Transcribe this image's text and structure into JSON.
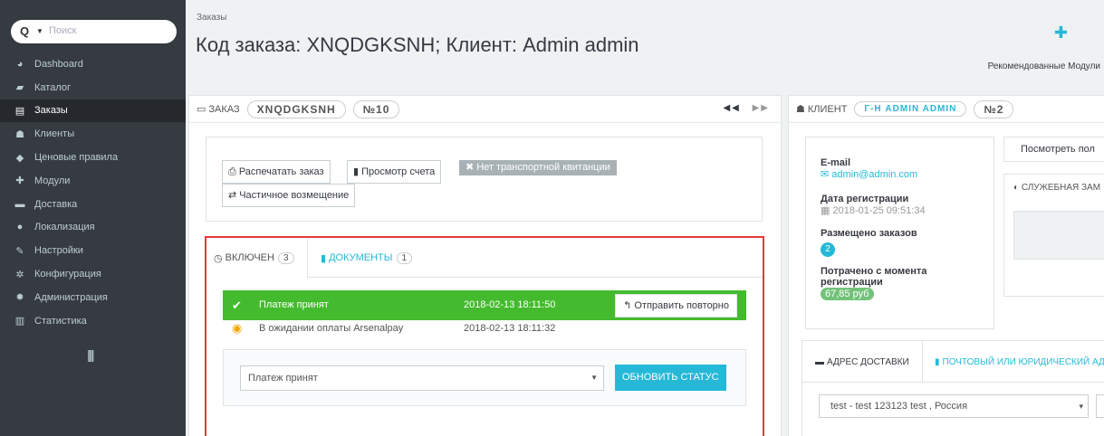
{
  "search": {
    "placeholder": "Поиск"
  },
  "sidebar": {
    "items": [
      {
        "label": "Dashboard",
        "icon": "dashboard-icon",
        "glyph": "◕",
        "active": false
      },
      {
        "label": "Каталог",
        "icon": "catalog-icon",
        "glyph": "▰",
        "active": false
      },
      {
        "label": "Заказы",
        "icon": "orders-icon",
        "glyph": "▤",
        "active": true
      },
      {
        "label": "Клиенты",
        "icon": "customers-icon",
        "glyph": "☗",
        "active": false
      },
      {
        "label": "Ценовые правила",
        "icon": "price-rules-icon",
        "glyph": "◆",
        "active": false
      },
      {
        "label": "Модули",
        "icon": "modules-icon",
        "glyph": "✚",
        "active": false
      },
      {
        "label": "Доставка",
        "icon": "delivery-icon",
        "glyph": "▬",
        "active": false
      },
      {
        "label": "Локализация",
        "icon": "localization-icon",
        "glyph": "●",
        "active": false
      },
      {
        "label": "Настройки",
        "icon": "settings-icon",
        "glyph": "✎",
        "active": false
      },
      {
        "label": "Конфигурация",
        "icon": "configuration-icon",
        "glyph": "✲",
        "active": false
      },
      {
        "label": "Администрация",
        "icon": "administration-icon",
        "glyph": "✹",
        "active": false
      },
      {
        "label": "Статистика",
        "icon": "statistics-icon",
        "glyph": "▥",
        "active": false
      }
    ],
    "collapse_glyph": "||||"
  },
  "header": {
    "breadcrumb": "Заказы",
    "title": "Код заказа: XNQDGKSNH; Клиент: Admin admin",
    "modules_label": "Рекомендованные Модули"
  },
  "order_panel": {
    "heading": "ЗАКАЗ",
    "reference": "XNQDGKSNH",
    "number": "№10",
    "buttons": {
      "print": "Распечатать заказ",
      "invoice": "Просмотр счета",
      "no_delivery_slip": "Нет транспортной квитанции",
      "partial_refund": "Частичное возмещение"
    },
    "tabs": {
      "included_label": "ВКЛЮЧЕН",
      "included_count": "3",
      "documents_label": "ДОКУМЕНТЫ",
      "documents_count": "1"
    },
    "history": [
      {
        "status": "Платеж принят",
        "date": "2018-02-13 18:11:50",
        "resend": "Отправить повторно"
      },
      {
        "status": "В ожидании оплаты Arsenalpay",
        "date": "2018-02-13 18:11:32"
      }
    ],
    "status_select": "Платеж принят",
    "update_button": "ОБНОВИТЬ СТАТУС"
  },
  "customer_panel": {
    "heading": "КЛИЕНТ",
    "name": "Г-Н ADMIN ADMIN",
    "number": "№2",
    "email_label": "E-mail",
    "email": "admin@admin.com",
    "registration_label": "Дата регистрации",
    "registration_date": "2018-01-25 09:51:34",
    "orders_label": "Размещено заказов",
    "orders_count": "2",
    "spent_label_1": "Потрачено с момента",
    "spent_label_2": "регистрации",
    "spent_value": "67,85 руб",
    "view_profile": "Посмотреть пол",
    "private_note": "СЛУЖЕБНАЯ ЗАМ",
    "address_tabs": {
      "shipping": "АДРЕС ДОСТАВКИ",
      "invoice": "ПОЧТОВЫЙ ИЛИ ЮРИДИЧЕСКИЙ АД"
    },
    "address_select": "test - test 123123 test , Россия"
  },
  "colors": {
    "accent": "#25b9d7",
    "success": "#44bb2e",
    "highlight_border": "#e4393c",
    "sidebar": "#363a41"
  }
}
